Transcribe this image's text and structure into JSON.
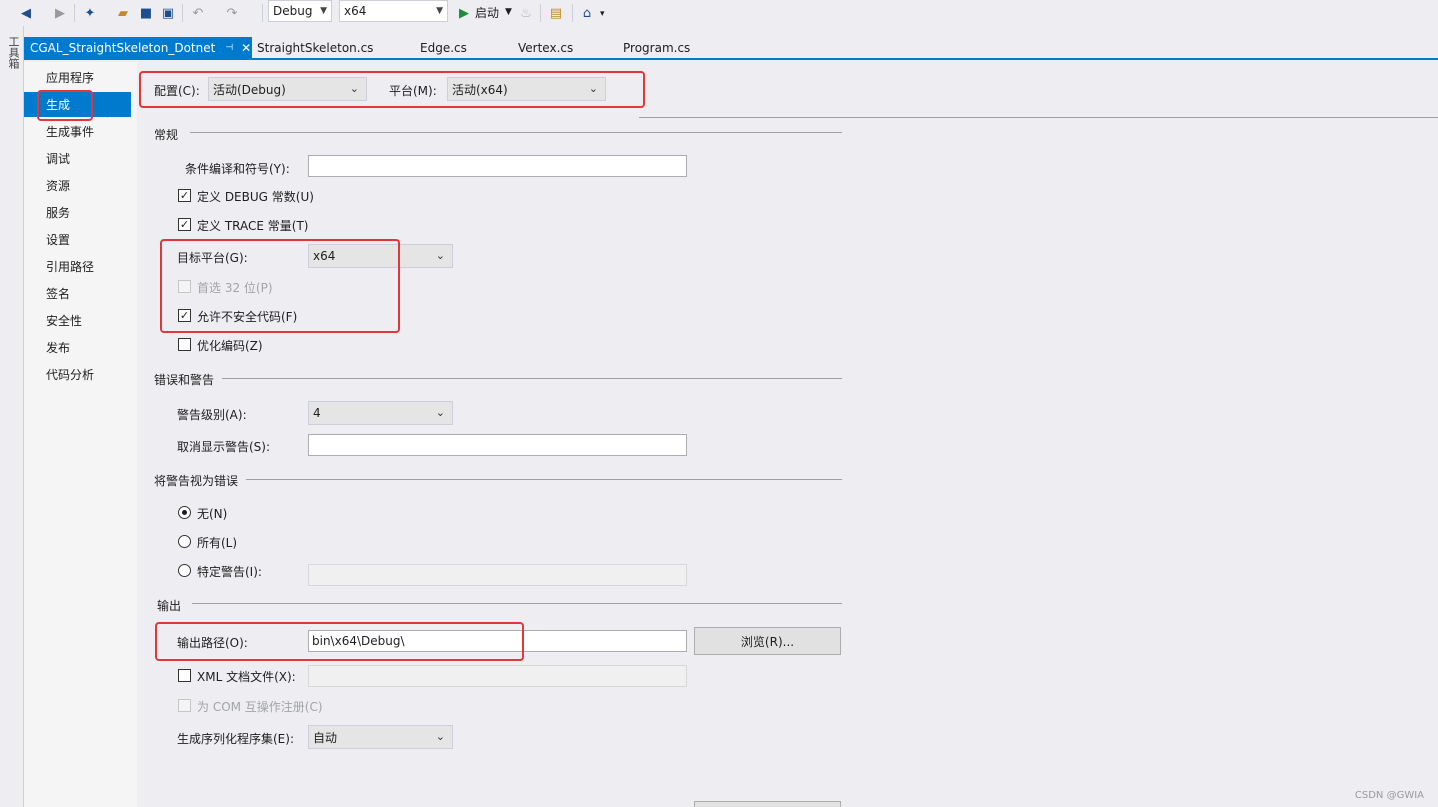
{
  "toolbar": {
    "config_value": "Debug",
    "platform_value": "x64",
    "start_label": "启动"
  },
  "side_strip": {
    "label": "工具箱"
  },
  "tabs": [
    {
      "label": "CGAL_StraightSkeleton_Dotnet",
      "active": true
    },
    {
      "label": "StraightSkeleton.cs"
    },
    {
      "label": "Edge.cs"
    },
    {
      "label": "Vertex.cs"
    },
    {
      "label": "Program.cs"
    }
  ],
  "nav": {
    "items": [
      "应用程序",
      "生成",
      "生成事件",
      "调试",
      "资源",
      "服务",
      "设置",
      "引用路径",
      "签名",
      "安全性",
      "发布",
      "代码分析"
    ],
    "selected": "生成"
  },
  "header": {
    "config_label": "配置(C):",
    "config_value": "活动(Debug)",
    "platform_label": "平台(M):",
    "platform_value": "活动(x64)"
  },
  "general": {
    "title": "常规",
    "conditional_label": "条件编译和符号(Y):",
    "conditional_value": "",
    "define_debug_label": "定义 DEBUG 常数(U)",
    "define_debug_checked": true,
    "define_trace_label": "定义 TRACE 常量(T)",
    "define_trace_checked": true,
    "target_label": "目标平台(G):",
    "target_value": "x64",
    "prefer32_label": "首选 32 位(P)",
    "prefer32_checked": false,
    "unsafe_label": "允许不安全代码(F)",
    "unsafe_checked": true,
    "optimize_label": "优化编码(Z)",
    "optimize_checked": false
  },
  "errors": {
    "title": "错误和警告",
    "level_label": "警告级别(A):",
    "level_value": "4",
    "suppress_label": "取消显示警告(S):",
    "suppress_value": ""
  },
  "treat_warnings": {
    "title": "将警告视为错误",
    "none_label": "无(N)",
    "all_label": "所有(L)",
    "specific_label": "特定警告(I):",
    "selected": "none"
  },
  "output": {
    "title": "输出",
    "path_label": "输出路径(O):",
    "path_value": "bin\\x64\\Debug\\",
    "browse_label": "浏览(R)...",
    "xml_label": "XML 文档文件(X):",
    "xml_checked": false,
    "com_label": "为 COM 互操作注册(C)",
    "com_checked": false,
    "serialization_label": "生成序列化程序集(E):",
    "serialization_value": "自动"
  },
  "watermark": "CSDN @GWIA",
  "colors": {
    "accent": "#007acc",
    "highlight": "#e0373b"
  }
}
